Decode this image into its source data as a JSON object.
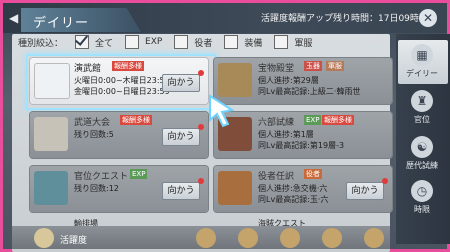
{
  "header": {
    "title": "デイリー",
    "timer": "活躍度報酬アップ残り時間：17日09時間"
  },
  "filter": {
    "label": "種別絞込：",
    "options": [
      "全て",
      "EXP",
      "役者",
      "装備",
      "軍服"
    ]
  },
  "cards": [
    {
      "title": "演武館",
      "tag": "報酬多様",
      "tag_color": "#d9493f",
      "lines": [
        "火曜日0:00~木曜日23:59",
        "金曜日0:00~日曜日23:59"
      ],
      "button": "向かう",
      "dim": false
    },
    {
      "title": "宝物殿堂",
      "tag": "玉器",
      "tag2": "軍服",
      "tag_color": "#c9514a",
      "lines": [
        "個人進捗:第29層",
        "同Lv最高記録:上級二·韓雨世"
      ],
      "button": "向かう",
      "dim": true
    },
    {
      "title": "武道大会",
      "tag": "報酬多様",
      "tag_color": "#d9493f",
      "lines": [
        "残り回数:5"
      ],
      "button": "向かう",
      "dim": true
    },
    {
      "title": "六部試練",
      "tag": "EXP",
      "tag2": "報酬多様",
      "tag_color": "#5c9a58",
      "lines": [
        "個人進捗:第1層",
        "同Lv最高記録:第19層-3"
      ],
      "button": "向かう",
      "dim": true
    },
    {
      "title": "官位クエスト",
      "tag": "EXP",
      "tag_color": "#5c9a58",
      "lines": [
        "残り回数:12"
      ],
      "button": "向かう",
      "dim": true
    },
    {
      "title": "役者任訳",
      "tag": "役者",
      "tag_color": "#c96a3a",
      "lines": [
        "個人進捗:急交機·六",
        "同Lv最高記録:玉·六"
      ],
      "button": "向かう",
      "dim": true
    }
  ],
  "partial_rows": [
    "輸排場",
    "海賊クエスト"
  ],
  "bottom": {
    "label": "活躍度"
  },
  "right_nav": [
    {
      "label": "デイリー",
      "icon": "calendar-icon"
    },
    {
      "label": "官位",
      "icon": "rank-icon"
    },
    {
      "label": "歴代試練",
      "icon": "trial-icon"
    },
    {
      "label": "時限",
      "icon": "clock-icon"
    }
  ],
  "colors": {
    "accent_pink": "#e84e9c",
    "tag_red": "#d9493f",
    "tag_green": "#5c9a58"
  }
}
